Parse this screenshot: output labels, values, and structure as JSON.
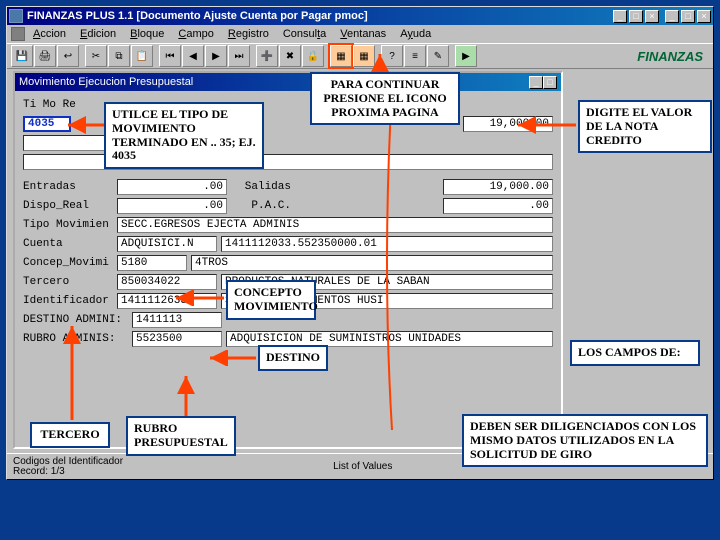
{
  "app": {
    "title": "FINANZAS PLUS 1.1  [Documento Ajuste Cuenta por Pagar  pmoc]",
    "menus": [
      "Accion",
      "Edicion",
      "Bloque",
      "Campo",
      "Registro",
      "Consulta",
      "Ventanas",
      "Ayuda"
    ],
    "logo": "FINANZAS"
  },
  "doc": {
    "title": "Movimiento Ejecucion Presupuestal",
    "header_row": "Ti Mo  Re",
    "tipo_mov_val": "4035",
    "valor": "19,000.00",
    "entradas_lbl": "Entradas",
    "entradas_val": ".00",
    "salidas_lbl": "Salidas",
    "salidas_val": "19,000.00",
    "dispo_lbl": "Dispo_Real",
    "dispo_val": ".00",
    "pac_lbl": "P.A.C.",
    "pac_val": ".00",
    "tipo_movimien_lbl": "Tipo Movimien",
    "tipo_movimien_val": "SECC.EGRESOS EJECTA ADMINIS",
    "cuenta_lbl": "Cuenta",
    "cuenta_val": "ADQUISICI.N",
    "cuenta_code": "1411112033.552350000.01",
    "concep_lbl": "Concep_Movimi",
    "concep_val": "5180",
    "concep_text": "4TROS",
    "tercero_lbl": "Tercero",
    "tercero_val": "850034022",
    "tercero_text": "PRODUCTOS NATURALES DE LA SABAN",
    "identi_lbl": "Identificador",
    "identi_val": "1411112633",
    "identi_text": "SERVICIOS ALIMENTOS HUSI",
    "destino_lbl": "DESTINO ADMINI:",
    "destino_val": "1411113",
    "rubro_lbl": "RUBRO ADMINIS:",
    "rubro_val": "5523500",
    "rubro_text": "ADQUISICION DE SUMINISTROS UNIDADES"
  },
  "status": {
    "left": "Codigos del Identificador",
    "record": "Record: 1/3",
    "right": "List of Values"
  },
  "callouts": {
    "tipo": "UTILCE EL TIPO DE MOVIMIENTO TERMINADO EN .. 35;  EJ. 4035",
    "continuar": "PARA CONTINUAR PRESIONE EL ICONO PROXIMA PAGINA",
    "valor": "DIGITE EL VALOR DE LA NOTA CREDITO",
    "concepto": "CONCEPTO MOVIMIENTO",
    "destino": "DESTINO",
    "campos": "LOS CAMPOS DE:",
    "tercero_lbl": "TERCERO",
    "rubro": "RUBRO PRESUPUESTAL",
    "diligenciados": "DEBEN SER DILIGENCIADOS CON LOS MISMO DATOS UTILIZADOS EN LA SOLICITUD DE GIRO"
  }
}
